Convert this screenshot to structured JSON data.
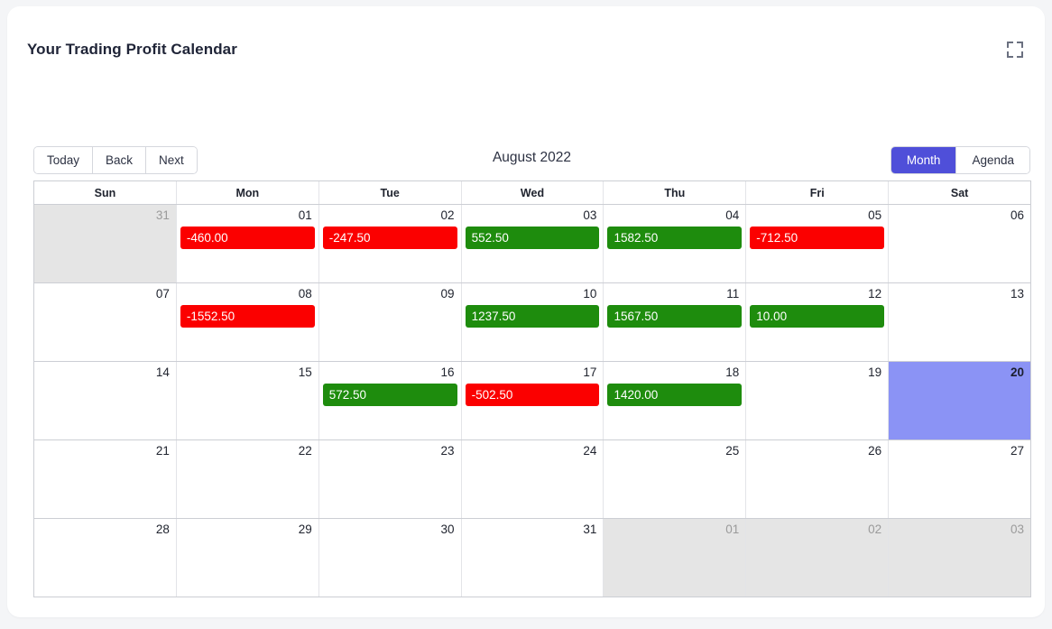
{
  "card": {
    "title": "Your Trading Profit Calendar",
    "fullscreen_icon": "fullscreen-expand-icon"
  },
  "toolbar": {
    "nav_buttons": [
      {
        "label": "Today",
        "name": "today-button"
      },
      {
        "label": "Back",
        "name": "back-button"
      },
      {
        "label": "Next",
        "name": "next-button"
      }
    ],
    "current_label": "August 2022",
    "views": [
      {
        "label": "Month",
        "active": true
      },
      {
        "label": "Agenda",
        "active": false
      }
    ]
  },
  "calendar": {
    "day_headers": [
      "Sun",
      "Mon",
      "Tue",
      "Wed",
      "Thu",
      "Fri",
      "Sat"
    ],
    "colors": {
      "profit": "#1e8c0d",
      "loss": "#fb0000",
      "today": "#8b93f5",
      "off_month": "#e5e5e5",
      "accent": "#4f4fd9"
    },
    "weeks": [
      [
        {
          "date": "31",
          "off": true,
          "today": false,
          "event": null
        },
        {
          "date": "01",
          "off": false,
          "today": false,
          "event": {
            "value": "-460.00",
            "sign": "neg"
          }
        },
        {
          "date": "02",
          "off": false,
          "today": false,
          "event": {
            "value": "-247.50",
            "sign": "neg"
          }
        },
        {
          "date": "03",
          "off": false,
          "today": false,
          "event": {
            "value": "552.50",
            "sign": "pos"
          }
        },
        {
          "date": "04",
          "off": false,
          "today": false,
          "event": {
            "value": "1582.50",
            "sign": "pos"
          }
        },
        {
          "date": "05",
          "off": false,
          "today": false,
          "event": {
            "value": "-712.50",
            "sign": "neg"
          }
        },
        {
          "date": "06",
          "off": false,
          "today": false,
          "event": null
        }
      ],
      [
        {
          "date": "07",
          "off": false,
          "today": false,
          "event": null
        },
        {
          "date": "08",
          "off": false,
          "today": false,
          "event": {
            "value": "-1552.50",
            "sign": "neg"
          }
        },
        {
          "date": "09",
          "off": false,
          "today": false,
          "event": null
        },
        {
          "date": "10",
          "off": false,
          "today": false,
          "event": {
            "value": "1237.50",
            "sign": "pos"
          }
        },
        {
          "date": "11",
          "off": false,
          "today": false,
          "event": {
            "value": "1567.50",
            "sign": "pos"
          }
        },
        {
          "date": "12",
          "off": false,
          "today": false,
          "event": {
            "value": "10.00",
            "sign": "pos"
          }
        },
        {
          "date": "13",
          "off": false,
          "today": false,
          "event": null
        }
      ],
      [
        {
          "date": "14",
          "off": false,
          "today": false,
          "event": null
        },
        {
          "date": "15",
          "off": false,
          "today": false,
          "event": null
        },
        {
          "date": "16",
          "off": false,
          "today": false,
          "event": {
            "value": "572.50",
            "sign": "pos"
          }
        },
        {
          "date": "17",
          "off": false,
          "today": false,
          "event": {
            "value": "-502.50",
            "sign": "neg"
          }
        },
        {
          "date": "18",
          "off": false,
          "today": false,
          "event": {
            "value": "1420.00",
            "sign": "pos"
          }
        },
        {
          "date": "19",
          "off": false,
          "today": false,
          "event": null
        },
        {
          "date": "20",
          "off": false,
          "today": true,
          "event": null
        }
      ],
      [
        {
          "date": "21",
          "off": false,
          "today": false,
          "event": null
        },
        {
          "date": "22",
          "off": false,
          "today": false,
          "event": null
        },
        {
          "date": "23",
          "off": false,
          "today": false,
          "event": null
        },
        {
          "date": "24",
          "off": false,
          "today": false,
          "event": null
        },
        {
          "date": "25",
          "off": false,
          "today": false,
          "event": null
        },
        {
          "date": "26",
          "off": false,
          "today": false,
          "event": null
        },
        {
          "date": "27",
          "off": false,
          "today": false,
          "event": null
        }
      ],
      [
        {
          "date": "28",
          "off": false,
          "today": false,
          "event": null
        },
        {
          "date": "29",
          "off": false,
          "today": false,
          "event": null
        },
        {
          "date": "30",
          "off": false,
          "today": false,
          "event": null
        },
        {
          "date": "31",
          "off": false,
          "today": false,
          "event": null
        },
        {
          "date": "01",
          "off": true,
          "today": false,
          "event": null
        },
        {
          "date": "02",
          "off": true,
          "today": false,
          "event": null
        },
        {
          "date": "03",
          "off": true,
          "today": false,
          "event": null
        }
      ]
    ]
  }
}
